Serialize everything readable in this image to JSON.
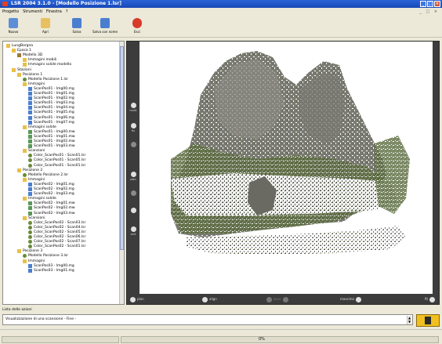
{
  "window": {
    "title": "LSR 2004 3.1.0 - [Modello Posizione 1.lsr]"
  },
  "menu": [
    "Progetto",
    "Strumenti",
    "Finestra",
    "?"
  ],
  "toolbar": {
    "nuovo": "Nuovo",
    "apri": "Apri",
    "salva": "Salva",
    "salva_come": "Salva con nome",
    "esci": "Esci"
  },
  "tree": [
    {
      "label": "LungBorgna",
      "indent": 0,
      "icon": "folder-icon"
    },
    {
      "label": "Epoca 1",
      "indent": 1,
      "icon": "folder-icon"
    },
    {
      "label": "Modello 3D",
      "indent": 2,
      "icon": "model-icon"
    },
    {
      "label": "Immagini mobili",
      "indent": 3,
      "icon": "folder-icon"
    },
    {
      "label": "Immagini solide modello",
      "indent": 3,
      "icon": "folder-icon"
    },
    {
      "label": "Stazioni",
      "indent": 1,
      "icon": "folder-icon"
    },
    {
      "label": "Posizione 1",
      "indent": 2,
      "icon": "folder-icon"
    },
    {
      "label": "Modello Posizione 1.lsr",
      "indent": 3,
      "icon": "gear-icon"
    },
    {
      "label": "Immagini",
      "indent": 3,
      "icon": "folder-icon"
    },
    {
      "label": "ScanPos01 - Img00.mg",
      "indent": 4,
      "icon": "doc-icon"
    },
    {
      "label": "ScanPos01 - Img01.mg",
      "indent": 4,
      "icon": "doc-icon"
    },
    {
      "label": "ScanPos01 - Img02.mg",
      "indent": 4,
      "icon": "doc-icon"
    },
    {
      "label": "ScanPos01 - Img03.mg",
      "indent": 4,
      "icon": "doc-icon"
    },
    {
      "label": "ScanPos01 - Img04.mg",
      "indent": 4,
      "icon": "doc-icon"
    },
    {
      "label": "ScanPos01 - Img05.mg",
      "indent": 4,
      "icon": "doc-icon"
    },
    {
      "label": "ScanPos01 - Img06.mg",
      "indent": 4,
      "icon": "doc-icon"
    },
    {
      "label": "ScanPos01 - Img07.mg",
      "indent": 4,
      "icon": "doc-icon"
    },
    {
      "label": "Immagini solide",
      "indent": 3,
      "icon": "folder-icon"
    },
    {
      "label": "ScanPos01 - Img00.mw",
      "indent": 4,
      "icon": "scan-icon"
    },
    {
      "label": "ScanPos01 - Img01.mw",
      "indent": 4,
      "icon": "scan-icon"
    },
    {
      "label": "ScanPos01 - Img02.mw",
      "indent": 4,
      "icon": "scan-icon"
    },
    {
      "label": "ScanPos01 - Img03.mw",
      "indent": 4,
      "icon": "scan-icon"
    },
    {
      "label": "Scansioni",
      "indent": 3,
      "icon": "folder-icon"
    },
    {
      "label": "Color_ScanPos01 - Scan01.lsr",
      "indent": 4,
      "icon": "gear-icon"
    },
    {
      "label": "Color_ScanPos01 - Scan05.lsr",
      "indent": 4,
      "icon": "gear-icon"
    },
    {
      "label": "Color_ScanPos01 - Scan01.lsr",
      "indent": 4,
      "icon": "gear-icon"
    },
    {
      "label": "Posizione 2",
      "indent": 2,
      "icon": "folder-icon"
    },
    {
      "label": "Modello Posizione 2.lsr",
      "indent": 3,
      "icon": "gear-icon"
    },
    {
      "label": "Immagini",
      "indent": 3,
      "icon": "folder-icon"
    },
    {
      "label": "ScanPos02 - Img01.mg",
      "indent": 4,
      "icon": "doc-icon"
    },
    {
      "label": "ScanPos02 - Img02.mg",
      "indent": 4,
      "icon": "doc-icon"
    },
    {
      "label": "ScanPos02 - Img03.mg",
      "indent": 4,
      "icon": "doc-icon"
    },
    {
      "label": "Immagini solide",
      "indent": 3,
      "icon": "folder-icon"
    },
    {
      "label": "ScanPos02 - Img01.mw",
      "indent": 4,
      "icon": "scan-icon"
    },
    {
      "label": "ScanPos02 - Img02.mw",
      "indent": 4,
      "icon": "scan-icon"
    },
    {
      "label": "ScanPos02 - Img03.mw",
      "indent": 4,
      "icon": "scan-icon"
    },
    {
      "label": "Scansioni",
      "indent": 3,
      "icon": "folder-icon"
    },
    {
      "label": "Color_ScanPos02 - Scan03.lsr",
      "indent": 4,
      "icon": "gear-icon"
    },
    {
      "label": "Color_ScanPos02 - Scan04.lsr",
      "indent": 4,
      "icon": "gear-icon"
    },
    {
      "label": "Color_ScanPos02 - Scan05.lsr",
      "indent": 4,
      "icon": "gear-icon"
    },
    {
      "label": "Color_ScanPos02 - Scan06.lsr",
      "indent": 4,
      "icon": "gear-icon"
    },
    {
      "label": "Color_ScanPos02 - Scan07.lsr",
      "indent": 4,
      "icon": "gear-icon"
    },
    {
      "label": "Color_ScanPos02 - Scan01.lsr",
      "indent": 4,
      "icon": "gear-icon"
    },
    {
      "label": "Posizione 3",
      "indent": 2,
      "icon": "folder-icon"
    },
    {
      "label": "Modello Posizione 3.lsr",
      "indent": 3,
      "icon": "gear-icon"
    },
    {
      "label": "Immagini",
      "indent": 3,
      "icon": "folder-icon"
    },
    {
      "label": "ScanPos03 - Img00.mg",
      "indent": 4,
      "icon": "doc-icon"
    },
    {
      "label": "ScanPos03 - Img01.mg",
      "indent": 4,
      "icon": "doc-icon"
    }
  ],
  "viewer": {
    "side_tools": [
      "multi",
      "fix",
      "",
      "plan",
      "",
      "",
      "vert"
    ],
    "bottom": {
      "plan": "plan",
      "align": "align",
      "base": "base",
      "maximize": "massimo",
      "fit": "fit"
    }
  },
  "lista": {
    "label": "Lista delle azioni",
    "value": "Visualizzazione di una scansione - Fine -"
  },
  "status": {
    "progress_text": "0%"
  }
}
